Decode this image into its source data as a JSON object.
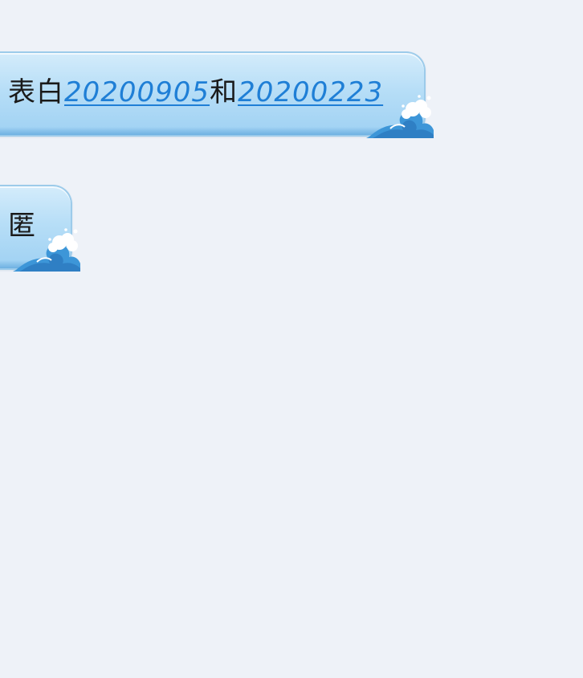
{
  "messages": [
    {
      "prefix": "表白",
      "link1": "20200905",
      "middle": "和",
      "link2": "20200223"
    },
    {
      "text": "匿"
    }
  ],
  "colors": {
    "background": "#eef2f8",
    "bubble_light": "#d4ecfb",
    "bubble_dark": "#9fd1f3",
    "link": "#1f7fd6",
    "wave": "#3d96d8"
  },
  "icons": {
    "bubble_decoration": "wave-icon"
  }
}
